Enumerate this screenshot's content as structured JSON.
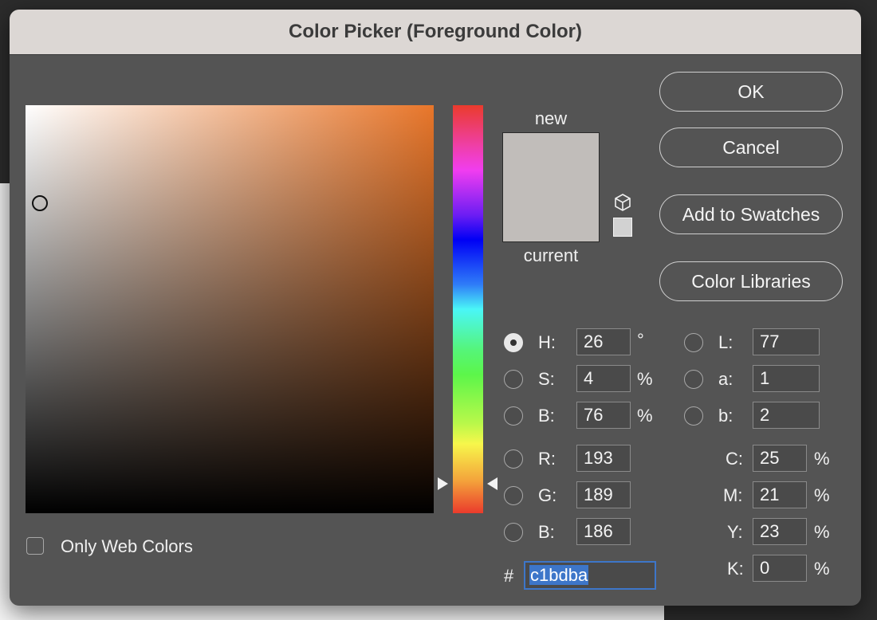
{
  "dialog": {
    "title": "Color Picker (Foreground Color)"
  },
  "buttons": {
    "ok": "OK",
    "cancel": "Cancel",
    "add_to_swatches": "Add to Swatches",
    "color_libraries": "Color Libraries"
  },
  "preview": {
    "new_label": "new",
    "current_label": "current",
    "current_color": "#c1bdba",
    "new_color": "#c1bdba",
    "gamut_icon": "cube-icon",
    "web_safe_swatch_color": "#d2d2d2"
  },
  "picker": {
    "hue_base_color": "#e8762a",
    "selected_mode": "H"
  },
  "hsb": {
    "h_label": "H:",
    "h_value": "26",
    "h_unit": "°",
    "s_label": "S:",
    "s_value": "4",
    "s_unit": "%",
    "b_label": "B:",
    "b_value": "76",
    "b_unit": "%"
  },
  "rgb": {
    "r_label": "R:",
    "r_value": "193",
    "g_label": "G:",
    "g_value": "189",
    "b_label": "B:",
    "b_value": "186"
  },
  "lab": {
    "l_label": "L:",
    "l_value": "77",
    "a_label": "a:",
    "a_value": "1",
    "b_label": "b:",
    "b_value": "2"
  },
  "cmyk": {
    "c_label": "C:",
    "c_value": "25",
    "c_unit": "%",
    "m_label": "M:",
    "m_value": "21",
    "m_unit": "%",
    "y_label": "Y:",
    "y_value": "23",
    "y_unit": "%",
    "k_label": "K:",
    "k_value": "0",
    "k_unit": "%"
  },
  "hex": {
    "hash_label": "#",
    "value": "c1bdba"
  },
  "options": {
    "only_web_colors_label": "Only Web Colors",
    "only_web_colors_checked": false
  }
}
